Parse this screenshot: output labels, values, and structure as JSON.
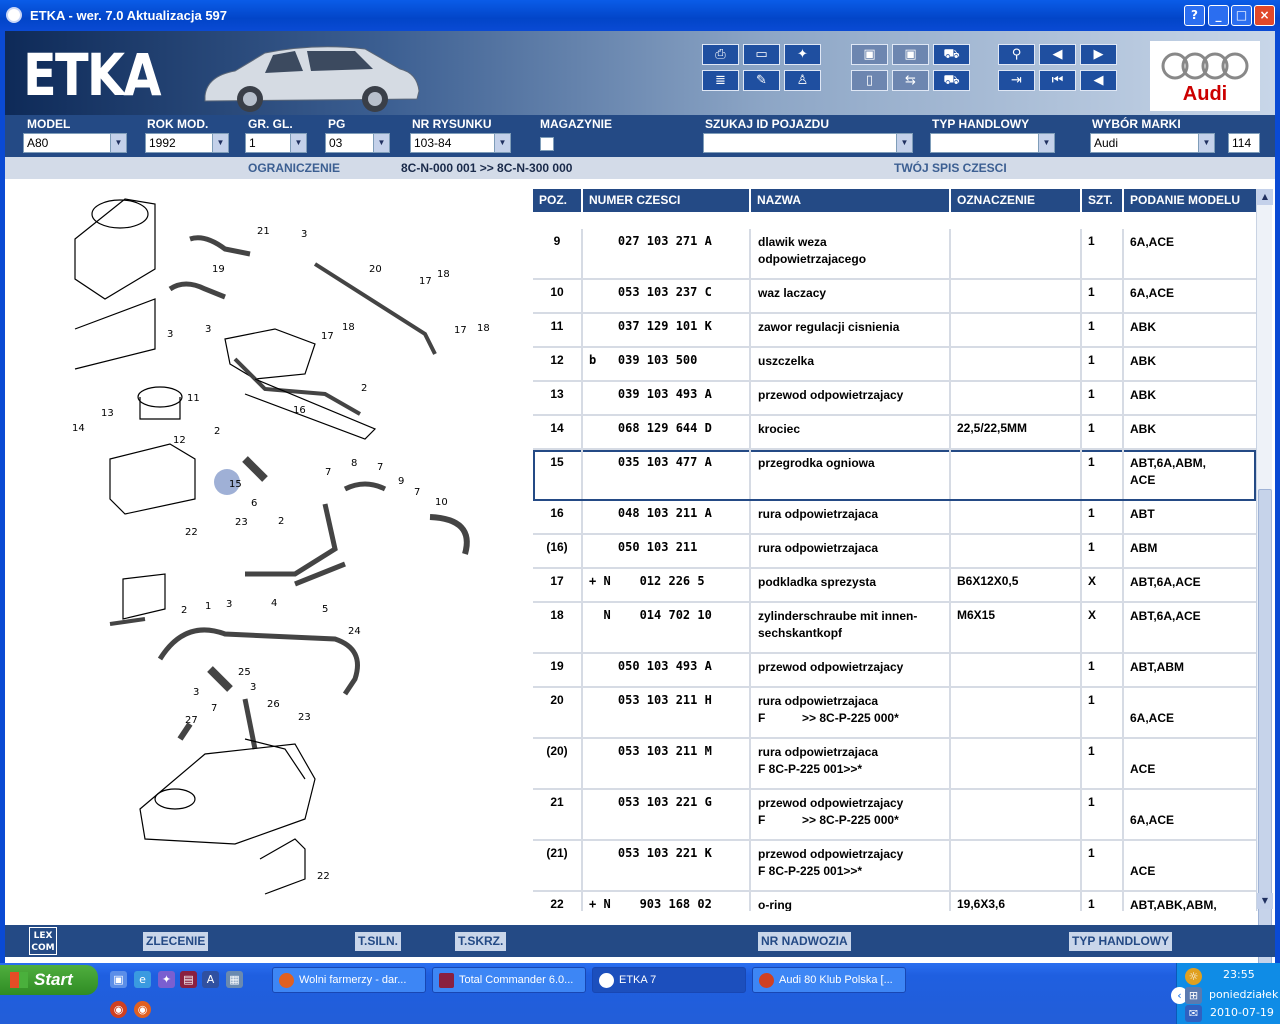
{
  "window": {
    "title": "ETKA - wer. 7.0 Aktualizacja 597",
    "btn_help": "?",
    "btn_min": "_",
    "btn_max": "□",
    "btn_close": "×"
  },
  "header": {
    "logo": "ETKA",
    "brand": "Audi"
  },
  "fields": {
    "model": {
      "label": "MODEL",
      "value": "A80"
    },
    "rok": {
      "label": "ROK MOD.",
      "value": "1992"
    },
    "grgl": {
      "label": "GR. GL.",
      "value": "1"
    },
    "pg": {
      "label": "PG",
      "value": "03"
    },
    "nr": {
      "label": "NR RYSUNKU",
      "value": "103-84"
    },
    "mag": {
      "label": "MAGAZYNIE"
    },
    "szukaj": {
      "label": "SZUKAJ ID POJAZDU",
      "value": ""
    },
    "typ": {
      "label": "TYP HANDLOWY",
      "value": ""
    },
    "marka": {
      "label": "WYBÓR MARKI",
      "value": "Audi",
      "extra": "114"
    }
  },
  "info": {
    "ogr_label": "OGRANICZENIE",
    "ogr_value": "8C-N-000 001 >> 8C-N-300 000",
    "spis": "TWÓJ SPIS CZESCI"
  },
  "table": {
    "headers": {
      "poz": "POZ.",
      "num": "NUMER CZESCI",
      "naz": "NAZWA",
      "ozn": "OZNACZENIE",
      "szt": "SZT.",
      "mod": "PODANIE MODELU"
    },
    "rows": [
      {
        "poz": "9",
        "num": "    027 103 271 A",
        "naz": "dlawik weza\nodpowietrzajacego",
        "ozn": "",
        "szt": "1",
        "mod": "6A,ACE"
      },
      {
        "poz": "10",
        "num": "    053 103 237 C",
        "naz": "waz laczacy",
        "ozn": "",
        "szt": "1",
        "mod": "6A,ACE"
      },
      {
        "poz": "11",
        "num": "    037 129 101 K",
        "naz": "zawor regulacji cisnienia",
        "ozn": "",
        "szt": "1",
        "mod": "ABK"
      },
      {
        "poz": "12",
        "num": "b   039 103 500",
        "naz": "uszczelka",
        "ozn": "",
        "szt": "1",
        "mod": "ABK"
      },
      {
        "poz": "13",
        "num": "    039 103 493 A",
        "naz": "przewod odpowietrzajacy",
        "ozn": "",
        "szt": "1",
        "mod": "ABK"
      },
      {
        "poz": "14",
        "num": "    068 129 644 D",
        "naz": "krociec",
        "ozn": "22,5/22,5MM",
        "szt": "1",
        "mod": "ABK"
      },
      {
        "poz": "15",
        "num": "    035 103 477 A",
        "naz": "przegrodka ogniowa",
        "ozn": "",
        "szt": "1",
        "mod": "ABT,6A,ABM,\nACE"
      },
      {
        "poz": "16",
        "num": "    048 103 211 A",
        "naz": "rura odpowietrzajaca",
        "ozn": "",
        "szt": "1",
        "mod": "ABT"
      },
      {
        "poz": "(16)",
        "num": "    050 103 211",
        "naz": "rura odpowietrzajaca",
        "ozn": "",
        "szt": "1",
        "mod": "ABM"
      },
      {
        "poz": "17",
        "num": "+ N    012 226 5",
        "naz": "podkladka sprezysta",
        "ozn": "B6X12X0,5",
        "szt": "X",
        "mod": "ABT,6A,ACE"
      },
      {
        "poz": "18",
        "num": "  N    014 702 10",
        "naz": "zylinderschraube mit innen-\nsechskantkopf",
        "ozn": "M6X15",
        "szt": "X",
        "mod": "ABT,6A,ACE"
      },
      {
        "poz": "19",
        "num": "    050 103 493 A",
        "naz": "przewod odpowietrzajacy",
        "ozn": "",
        "szt": "1",
        "mod": "ABT,ABM"
      },
      {
        "poz": "20",
        "num": "    053 103 211 H",
        "naz": "rura odpowietrzajaca\nF           >> 8C-P-225 000*",
        "ozn": "",
        "szt": "1",
        "mod": "\n6A,ACE"
      },
      {
        "poz": "(20)",
        "num": "    053 103 211 M",
        "naz": "rura odpowietrzajaca\nF 8C-P-225 001>>*",
        "ozn": "",
        "szt": "1",
        "mod": "\nACE"
      },
      {
        "poz": "21",
        "num": "    053 103 221 G",
        "naz": "przewod odpowietrzajacy\nF           >> 8C-P-225 000*",
        "ozn": "",
        "szt": "1",
        "mod": "\n6A,ACE"
      },
      {
        "poz": "(21)",
        "num": "    053 103 221 K",
        "naz": "przewod odpowietrzajacy\nF 8C-P-225 001>>*",
        "ozn": "",
        "szt": "1",
        "mod": "\nACE"
      },
      {
        "poz": "22",
        "num": "+ N    903 168 02",
        "naz": "o-ring",
        "ozn": "19,6X3,6",
        "szt": "1",
        "mod": "ABT,ABK,ABM,"
      }
    ]
  },
  "drawing": {
    "labels": [
      "21",
      "3",
      "19",
      "20",
      "17",
      "18",
      "3",
      "3",
      "17",
      "18",
      "17",
      "18",
      "16",
      "2",
      "11",
      "13",
      "12",
      "2",
      "14",
      "15",
      "6",
      "2",
      "7",
      "8",
      "7",
      "9",
      "7",
      "10",
      "22",
      "23",
      "2",
      "1",
      "3",
      "4",
      "5",
      "24",
      "25",
      "3",
      "3",
      "26",
      "23",
      "27",
      "7",
      "22"
    ]
  },
  "bottom": {
    "lex": "LEX\nCOM",
    "zlecenie": "ZLECENIE",
    "tsiln": "T.SILN.",
    "tskrz": "T.SKRZ.",
    "nadwozia": "NR NADWOZIA",
    "typ": "TYP HANDLOWY"
  },
  "taskbar": {
    "start": "Start",
    "tasks": [
      "Wolni farmerzy - dar...",
      "Total Commander 6.0...",
      "ETKA 7",
      "Audi 80 Klub Polska [..."
    ],
    "time": "23:55",
    "day": "poniedziałek",
    "date": "2010-07-19"
  }
}
